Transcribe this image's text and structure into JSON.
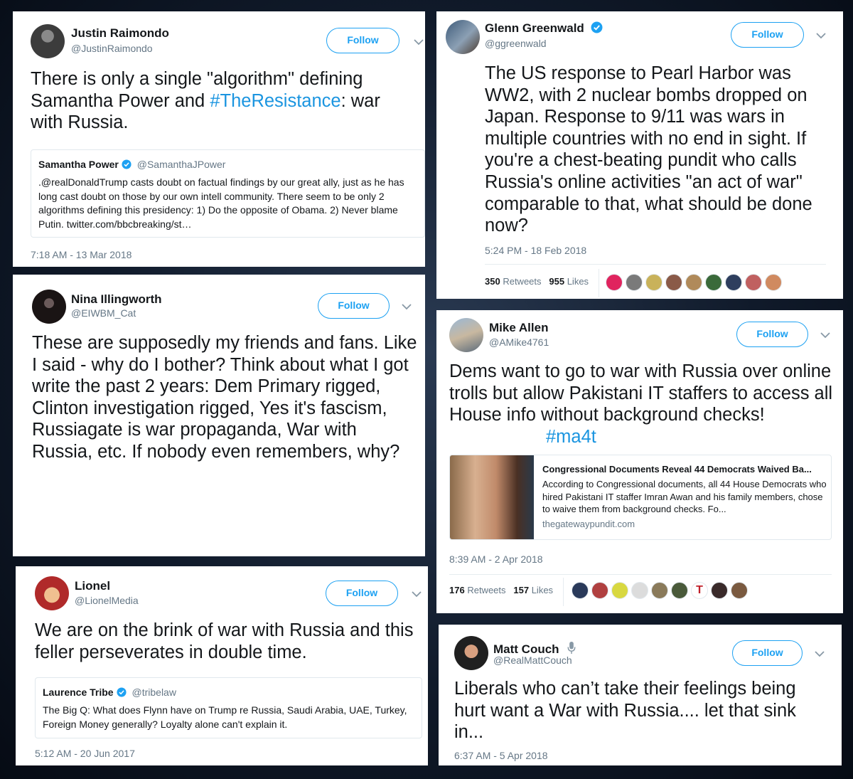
{
  "tweets": {
    "justin": {
      "name": "Justin Raimondo",
      "handle": "@JustinRaimondo",
      "follow": "Follow",
      "text_a": "There is only a single \"algorithm\" defining",
      "text_b1": "Samantha Power and ",
      "text_hashtag": "#TheResistance",
      "text_b2": ": war",
      "text_c": "with Russia.",
      "quote_name": "Samantha Power",
      "quote_handle": "@SamanthaJPower",
      "quote_text": ".@realDonaldTrump casts doubt on factual findings by our great ally, just as he has long cast doubt on those by our own intell community. There seem to be only 2 algorithms defining this presidency: 1) Do the opposite of Obama. 2) Never blame Putin. twitter.com/bbcbreaking/st…",
      "time": "7:18 AM - 13 Mar 2018"
    },
    "glenn": {
      "name": "Glenn Greenwald",
      "handle": "@ggreenwald",
      "follow": "Follow",
      "text": "The US response to Pearl Harbor was WW2, with 2 nuclear bombs dropped on Japan. Response to 9/11 was wars in multiple countries with no end in sight. If you're a chest-beating pundit who calls Russia's online activities \"an act of war\" comparable to that, what should be done now?",
      "time": "5:24 PM - 18 Feb 2018",
      "retweets": "350",
      "retweets_label": "Retweets",
      "likes": "955",
      "likes_label": "Likes"
    },
    "nina": {
      "name": "Nina Illingworth",
      "handle": "@EIWBM_Cat",
      "follow": "Follow",
      "p1": "These are supposedly my friends and fans.",
      "p2": "Like I said - why do I bother?",
      "p3": "Think about what I got write the past 2 years: Dem Primary rigged, Clinton investigation rigged, Yes it's fascism, Russiagate is war propaganda, War with Russia, etc.",
      "p4": "If nobody even remembers, why?"
    },
    "mike": {
      "name": "Mike Allen",
      "handle": "@AMike4761",
      "follow": "Follow",
      "text": "Dems want to go to war with Russia over online trolls but allow Pakistani IT staffers to access all House info without background checks!",
      "hashtag": "#ma4t",
      "card_title": "Congressional Documents Reveal 44 Democrats Waived Ba...",
      "card_desc": "According to Congressional documents, all 44 House Democrats who hired Pakistani IT staffer Imran Awan and his family members, chose to waive them from background checks. Fo...",
      "card_domain": "thegatewaypundit.com",
      "time": "8:39 AM - 2 Apr 2018",
      "retweets": "176",
      "retweets_label": "Retweets",
      "likes": "157",
      "likes_label": "Likes"
    },
    "lionel": {
      "name": "Lionel",
      "handle": "@LionelMedia",
      "follow": "Follow",
      "text": "We are on the brink of war with Russia and this feller perseverates in double time.",
      "quote_name": "Laurence Tribe",
      "quote_handle": "@tribelaw",
      "quote_text": "The Big Q: What does Flynn have on Trump re Russia, Saudi Arabia, UAE, Turkey, Foreign Money generally? Loyalty alone can't explain it.",
      "time": "5:12 AM - 20 Jun 2017"
    },
    "matt": {
      "name": "Matt Couch",
      "handle": "@RealMattCouch",
      "follow": "Follow",
      "text": "Liberals who can’t take their feelings being hurt want a War with Russia.... let that sink in...",
      "time": "6:37 AM - 5 Apr 2018"
    }
  },
  "colors": {
    "accent": "#1da1f2",
    "hashtag": "#1b95e0",
    "muted": "#657786",
    "verified": "#1da1f2"
  },
  "icons": [
    "chevron-down-icon",
    "verified-badge-icon",
    "microphone-icon"
  ]
}
